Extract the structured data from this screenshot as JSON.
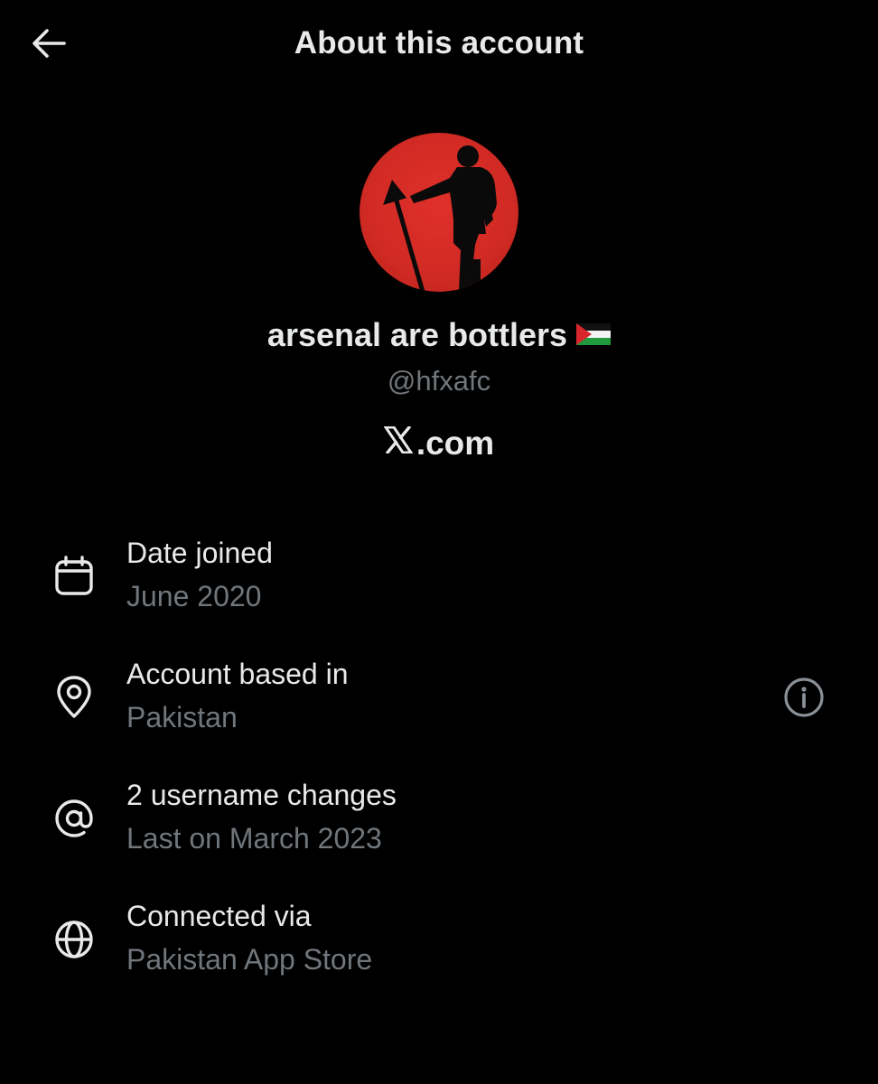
{
  "header": {
    "title": "About this account",
    "back_icon": "arrow-left-icon"
  },
  "profile": {
    "display_name": "arsenal are bottlers",
    "flag_icon": "palestine-flag-icon",
    "handle": "@hfxafc",
    "platform": ".com",
    "platform_icon": "x-logo-icon",
    "avatar_color": "#d62b25"
  },
  "details": [
    {
      "icon": "calendar-icon",
      "title": "Date joined",
      "value": "June 2020"
    },
    {
      "icon": "location-pin-icon",
      "title": "Account based in",
      "value": "Pakistan",
      "action_icon": "info-icon"
    },
    {
      "icon": "at-sign-icon",
      "title": "2 username changes",
      "value": "Last on March 2023"
    },
    {
      "icon": "globe-icon",
      "title": "Connected via",
      "value": "Pakistan App Store"
    }
  ],
  "colors": {
    "background": "#000000",
    "primary_text": "#e7e9ea",
    "secondary_text": "#71767b"
  }
}
